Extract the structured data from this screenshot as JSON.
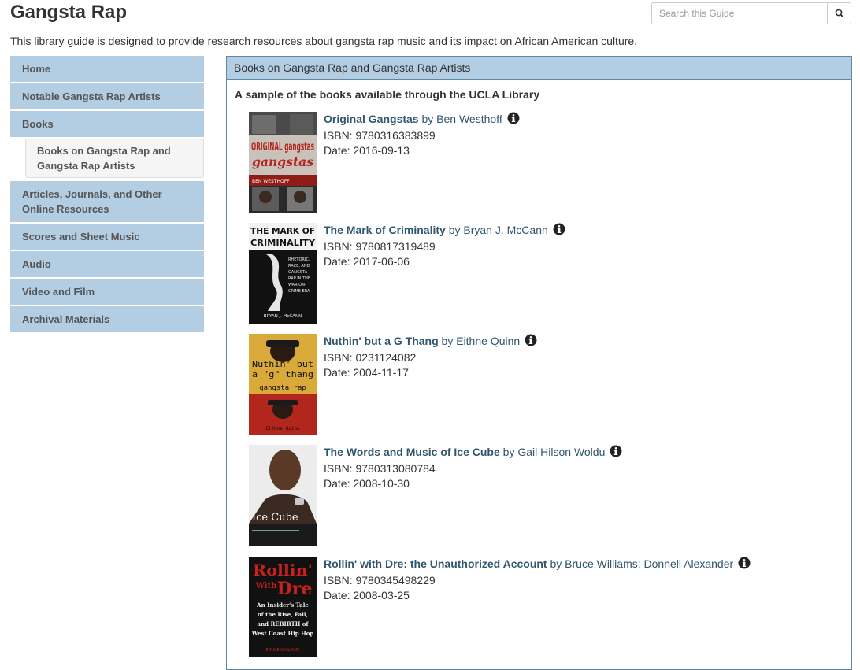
{
  "header": {
    "title": "Gangsta Rap",
    "search_placeholder": "Search this Guide",
    "description": "This library guide is designed to provide research resources about gangsta rap music and its impact on African American culture."
  },
  "nav": {
    "home": "Home",
    "artists": "Notable Gangsta Rap Artists",
    "books": "Books",
    "books_sub": "Books on Gangsta Rap and Gangsta Rap Artists",
    "articles": "Articles, Journals, and Other Online Resources",
    "scores": "Scores and Sheet Music",
    "audio": "Audio",
    "video": "Video and Film",
    "archival": "Archival Materials"
  },
  "panel": {
    "heading": "Books on Gangsta Rap and Gangsta Rap Artists",
    "subheading": "A sample of the books available through the UCLA Library"
  },
  "books": [
    {
      "title": "Original Gangstas",
      "by": "by",
      "author": "Ben Westhoff",
      "isbn": "ISBN: 9780316383899",
      "date": "Date: 2016-09-13",
      "cover_text": "ORIGINAL gangstas",
      "cover_author": "BEN WESTHOFF"
    },
    {
      "title": "The Mark of Criminality",
      "by": "by",
      "author": "Bryan J. McCann",
      "isbn": "ISBN: 9780817319489",
      "date": "Date: 2017-06-06",
      "cover_text": "THE MARK OF CRIMINALITY",
      "cover_sub": "RHETORIC, RACE, AND GANGSTA RAP IN THE WAR-ON-CRIME ERA",
      "cover_author": "BRYAN J. McCANN"
    },
    {
      "title": "Nuthin' but a G Thang",
      "by": "by",
      "author": "Eithne Quinn",
      "isbn": "ISBN: 0231124082",
      "date": "Date: 2004-11-17",
      "cover_text": "Nuthin' but a \"g\" thang",
      "cover_sub": "gangsta rap",
      "cover_author": "Eithne Quinn"
    },
    {
      "title": "The Words and Music of Ice Cube",
      "by": "by",
      "author": "Gail Hilson Woldu",
      "isbn": "ISBN: 9780313080784",
      "date": "Date: 2008-10-30",
      "cover_text": "Ice Cube"
    },
    {
      "title": "Rollin' with Dre: the Unauthorized Account",
      "by": "by",
      "author": "Bruce Williams; Donnell Alexander",
      "isbn": "ISBN: 9780345498229",
      "date": "Date: 2008-03-25",
      "cover_text": "Rollin' With Dre",
      "cover_sub": "An Insider's Tale of the Rise, Fall, and REBIRTH of West Coast Hip Hop"
    }
  ],
  "colors": {
    "nav_bg": "#b3cde3",
    "link": "#30566f",
    "panel_border": "#5f87a6"
  }
}
